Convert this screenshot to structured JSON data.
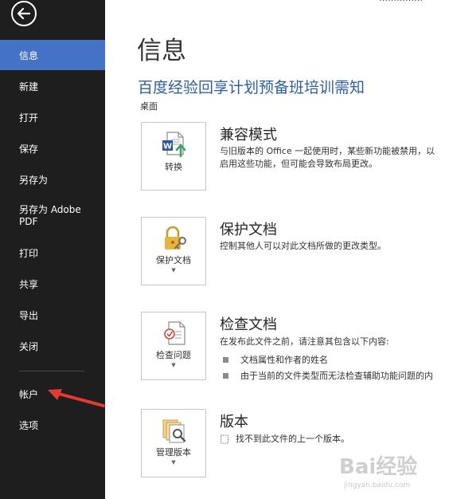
{
  "sidebar": {
    "items": [
      {
        "label": "信息",
        "active": true
      },
      {
        "label": "新建"
      },
      {
        "label": "打开"
      },
      {
        "label": "保存"
      },
      {
        "label": "另存为"
      },
      {
        "label": "另存为 Adobe\nPDF"
      },
      {
        "label": "打印"
      },
      {
        "label": "共享"
      },
      {
        "label": "导出"
      },
      {
        "label": "关闭"
      },
      {
        "label": "帐户"
      },
      {
        "label": "选项"
      }
    ],
    "colors": {
      "background": "#1e1e1e",
      "active": "#4472c4"
    }
  },
  "header": {
    "top_clipped_text": "……………"
  },
  "main": {
    "title": "信息",
    "doc_title": "百度经验回享计划预备班培训需知",
    "doc_location": "桌面",
    "sections": [
      {
        "tile_label": "转换",
        "icon": "word-convert-icon",
        "title": "兼容模式",
        "desc_lines": [
          "与旧版本的 Office 一起使用时，某些新功能被禁用，以",
          "启用这些功能，但可能会导致布局更改。"
        ]
      },
      {
        "tile_label": "保护文档",
        "icon": "lock-key-icon",
        "title": "保护文档",
        "desc_lines": [
          "控制其他人可以对此文档所做的更改类型。"
        ]
      },
      {
        "tile_label": "检查问题",
        "icon": "inspect-document-icon",
        "title": "检查文档",
        "desc_lines": [
          "在发布此文件之前，请注意其包含以下内容:"
        ],
        "bullets": [
          "文档属性和作者的姓名",
          "由于当前的文件类型而无法检查辅助功能问题的内"
        ]
      },
      {
        "tile_label": "管理版本",
        "icon": "manage-versions-icon",
        "title": "版本",
        "desc_lines": [
          "找不到此文件的上一个版本。"
        ]
      }
    ]
  },
  "watermark": {
    "text": "Bai经验",
    "sub": "jingyan.baidu.com"
  }
}
